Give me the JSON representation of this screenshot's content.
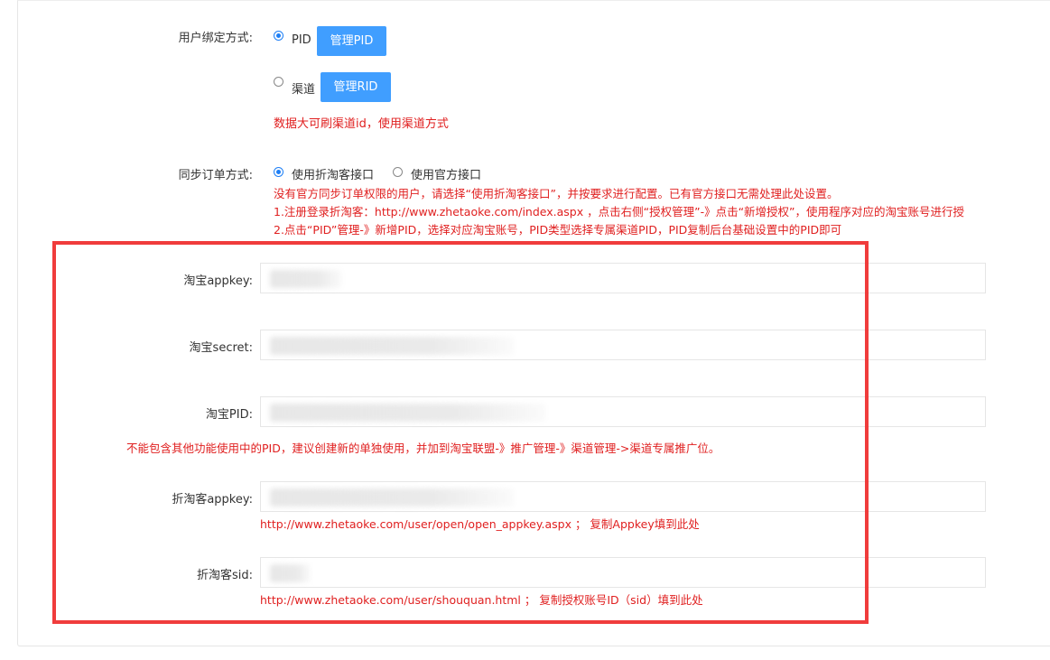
{
  "bind_method": {
    "label": "用户绑定方式:",
    "options": [
      {
        "text": "PID",
        "button": "管理PID",
        "checked": true
      },
      {
        "text": "渠道",
        "button": "管理RID",
        "checked": false
      }
    ],
    "hint": "数据大可刷渠道id，使用渠道方式"
  },
  "sync_method": {
    "label": "同步订单方式:",
    "options": [
      {
        "text": "使用折淘客接口",
        "checked": true
      },
      {
        "text": "使用官方接口",
        "checked": false
      }
    ],
    "hints": [
      "没有官方同步订单权限的用户，请选择“使用折淘客接口”，并按要求进行配置。已有官方接口无需处理此处设置。",
      "1.注册登录折淘客：http://www.zhetaoke.com/index.aspx ，点击右侧“授权管理”-》点击“新增授权”，使用程序对应的淘宝账号进行授",
      "2.点击“PID”管理-》新增PID，选择对应淘宝账号，PID类型选择专属渠道PID，PID复制后台基础设置中的PID即可"
    ]
  },
  "fields": {
    "taobao_appkey": {
      "label": "淘宝appkey:"
    },
    "taobao_secret": {
      "label": "淘宝secret:"
    },
    "taobao_pid": {
      "label": "淘宝PID:",
      "hint": "不能包含其他功能使用中的PID，建议创建新的单独使用，并加到淘宝联盟-》推广管理-》渠道管理->渠道专属推广位。"
    },
    "zhetaoke_appkey": {
      "label": "折淘客appkey:",
      "hint": "http://www.zhetaoke.com/user/open/open_appkey.aspx ； 复制Appkey填到此处"
    },
    "zhetaoke_sid": {
      "label": "折淘客sid:",
      "hint": "http://www.zhetaoke.com/user/shouquan.html ； 复制授权账号ID（sid）填到此处"
    }
  },
  "colors": {
    "accent": "#409eff",
    "warning_text": "#e02020",
    "highlight_border": "#f03c3c"
  }
}
